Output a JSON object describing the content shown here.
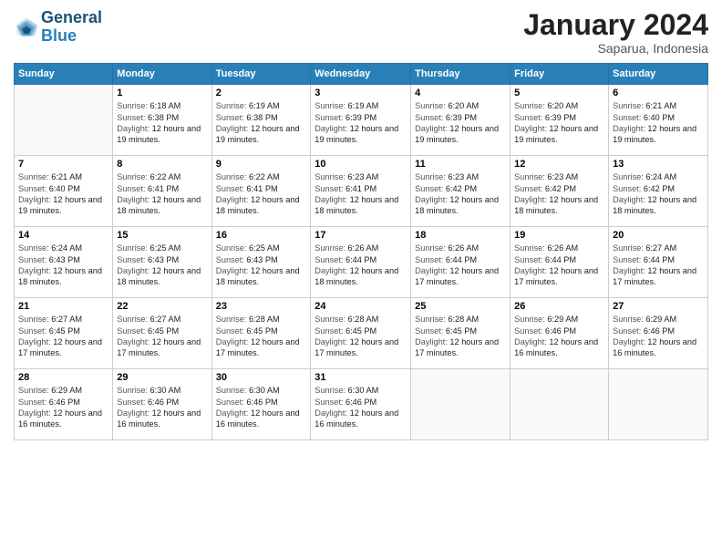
{
  "header": {
    "logo_line1": "General",
    "logo_line2": "Blue",
    "month_title": "January 2024",
    "subtitle": "Saparua, Indonesia"
  },
  "days_of_week": [
    "Sunday",
    "Monday",
    "Tuesday",
    "Wednesday",
    "Thursday",
    "Friday",
    "Saturday"
  ],
  "weeks": [
    [
      {
        "day": "",
        "sunrise": "",
        "sunset": "",
        "daylight": ""
      },
      {
        "day": "1",
        "sunrise": "6:18 AM",
        "sunset": "6:38 PM",
        "daylight": "12 hours and 19 minutes."
      },
      {
        "day": "2",
        "sunrise": "6:19 AM",
        "sunset": "6:38 PM",
        "daylight": "12 hours and 19 minutes."
      },
      {
        "day": "3",
        "sunrise": "6:19 AM",
        "sunset": "6:39 PM",
        "daylight": "12 hours and 19 minutes."
      },
      {
        "day": "4",
        "sunrise": "6:20 AM",
        "sunset": "6:39 PM",
        "daylight": "12 hours and 19 minutes."
      },
      {
        "day": "5",
        "sunrise": "6:20 AM",
        "sunset": "6:39 PM",
        "daylight": "12 hours and 19 minutes."
      },
      {
        "day": "6",
        "sunrise": "6:21 AM",
        "sunset": "6:40 PM",
        "daylight": "12 hours and 19 minutes."
      }
    ],
    [
      {
        "day": "7",
        "sunrise": "6:21 AM",
        "sunset": "6:40 PM",
        "daylight": "12 hours and 19 minutes."
      },
      {
        "day": "8",
        "sunrise": "6:22 AM",
        "sunset": "6:41 PM",
        "daylight": "12 hours and 18 minutes."
      },
      {
        "day": "9",
        "sunrise": "6:22 AM",
        "sunset": "6:41 PM",
        "daylight": "12 hours and 18 minutes."
      },
      {
        "day": "10",
        "sunrise": "6:23 AM",
        "sunset": "6:41 PM",
        "daylight": "12 hours and 18 minutes."
      },
      {
        "day": "11",
        "sunrise": "6:23 AM",
        "sunset": "6:42 PM",
        "daylight": "12 hours and 18 minutes."
      },
      {
        "day": "12",
        "sunrise": "6:23 AM",
        "sunset": "6:42 PM",
        "daylight": "12 hours and 18 minutes."
      },
      {
        "day": "13",
        "sunrise": "6:24 AM",
        "sunset": "6:42 PM",
        "daylight": "12 hours and 18 minutes."
      }
    ],
    [
      {
        "day": "14",
        "sunrise": "6:24 AM",
        "sunset": "6:43 PM",
        "daylight": "12 hours and 18 minutes."
      },
      {
        "day": "15",
        "sunrise": "6:25 AM",
        "sunset": "6:43 PM",
        "daylight": "12 hours and 18 minutes."
      },
      {
        "day": "16",
        "sunrise": "6:25 AM",
        "sunset": "6:43 PM",
        "daylight": "12 hours and 18 minutes."
      },
      {
        "day": "17",
        "sunrise": "6:26 AM",
        "sunset": "6:44 PM",
        "daylight": "12 hours and 18 minutes."
      },
      {
        "day": "18",
        "sunrise": "6:26 AM",
        "sunset": "6:44 PM",
        "daylight": "12 hours and 17 minutes."
      },
      {
        "day": "19",
        "sunrise": "6:26 AM",
        "sunset": "6:44 PM",
        "daylight": "12 hours and 17 minutes."
      },
      {
        "day": "20",
        "sunrise": "6:27 AM",
        "sunset": "6:44 PM",
        "daylight": "12 hours and 17 minutes."
      }
    ],
    [
      {
        "day": "21",
        "sunrise": "6:27 AM",
        "sunset": "6:45 PM",
        "daylight": "12 hours and 17 minutes."
      },
      {
        "day": "22",
        "sunrise": "6:27 AM",
        "sunset": "6:45 PM",
        "daylight": "12 hours and 17 minutes."
      },
      {
        "day": "23",
        "sunrise": "6:28 AM",
        "sunset": "6:45 PM",
        "daylight": "12 hours and 17 minutes."
      },
      {
        "day": "24",
        "sunrise": "6:28 AM",
        "sunset": "6:45 PM",
        "daylight": "12 hours and 17 minutes."
      },
      {
        "day": "25",
        "sunrise": "6:28 AM",
        "sunset": "6:45 PM",
        "daylight": "12 hours and 17 minutes."
      },
      {
        "day": "26",
        "sunrise": "6:29 AM",
        "sunset": "6:46 PM",
        "daylight": "12 hours and 16 minutes."
      },
      {
        "day": "27",
        "sunrise": "6:29 AM",
        "sunset": "6:46 PM",
        "daylight": "12 hours and 16 minutes."
      }
    ],
    [
      {
        "day": "28",
        "sunrise": "6:29 AM",
        "sunset": "6:46 PM",
        "daylight": "12 hours and 16 minutes."
      },
      {
        "day": "29",
        "sunrise": "6:30 AM",
        "sunset": "6:46 PM",
        "daylight": "12 hours and 16 minutes."
      },
      {
        "day": "30",
        "sunrise": "6:30 AM",
        "sunset": "6:46 PM",
        "daylight": "12 hours and 16 minutes."
      },
      {
        "day": "31",
        "sunrise": "6:30 AM",
        "sunset": "6:46 PM",
        "daylight": "12 hours and 16 minutes."
      },
      {
        "day": "",
        "sunrise": "",
        "sunset": "",
        "daylight": ""
      },
      {
        "day": "",
        "sunrise": "",
        "sunset": "",
        "daylight": ""
      },
      {
        "day": "",
        "sunrise": "",
        "sunset": "",
        "daylight": ""
      }
    ]
  ],
  "labels": {
    "sunrise": "Sunrise:",
    "sunset": "Sunset:",
    "daylight": "Daylight:"
  }
}
